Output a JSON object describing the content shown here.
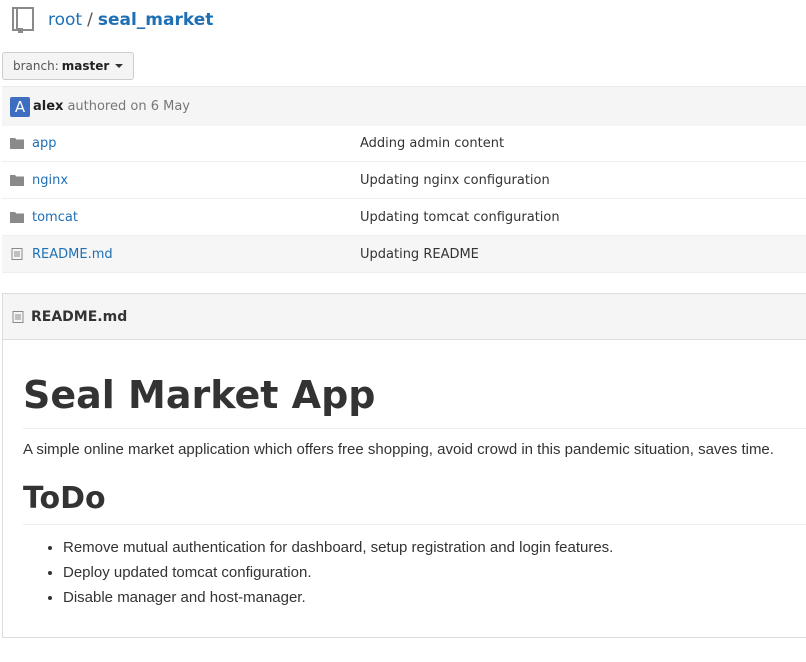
{
  "breadcrumb": {
    "root": "root",
    "separator": "/",
    "repo": "seal_market"
  },
  "branch": {
    "label": "branch:",
    "value": "master"
  },
  "commit": {
    "avatar_letter": "A",
    "author": "alex",
    "meta": "authored on 6 May"
  },
  "files": [
    {
      "name": "app",
      "type": "folder",
      "message": "Adding admin content"
    },
    {
      "name": "nginx",
      "type": "folder",
      "message": "Updating nginx configuration"
    },
    {
      "name": "tomcat",
      "type": "folder",
      "message": "Updating tomcat configuration"
    },
    {
      "name": "README.md",
      "type": "file",
      "message": "Updating README"
    }
  ],
  "readme": {
    "filename": "README.md",
    "title": "Seal Market App",
    "description": "A simple online market application which offers free shopping, avoid crowd in this pandemic situation, saves time.",
    "todo_heading": "ToDo",
    "todo_items": [
      "Remove mutual authentication for dashboard, setup registration and login features.",
      "Deploy updated tomcat configuration.",
      "Disable manager and host-manager."
    ]
  },
  "colors": {
    "link": "#1f6fb5",
    "avatar": "#3e6ec2",
    "icon": "#8a8a8a"
  }
}
